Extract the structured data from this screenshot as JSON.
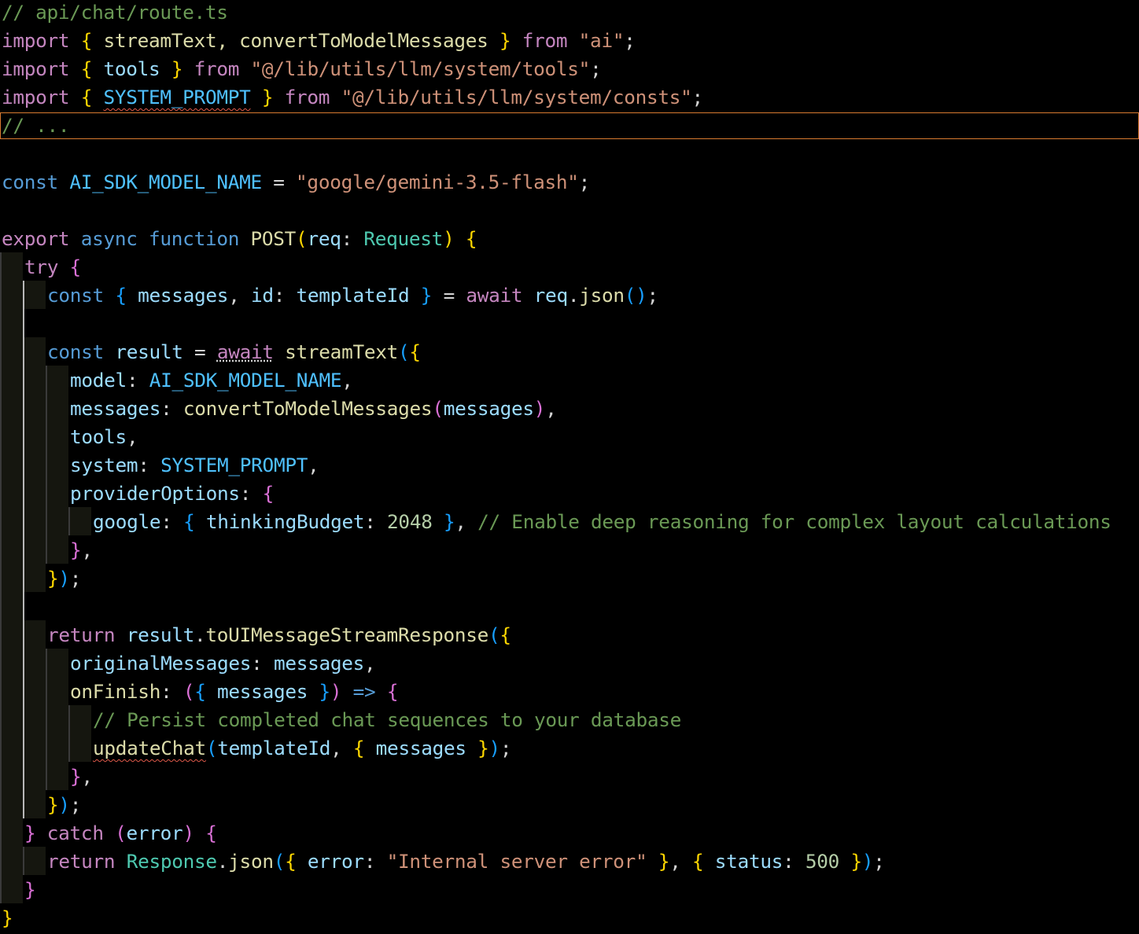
{
  "file_comment": "// api/chat/route.ts",
  "imports": [
    {
      "keyword": "import",
      "names": "streamText, convertToModelMessages",
      "from": "from",
      "source": "\"ai\""
    },
    {
      "keyword": "import",
      "names": "tools",
      "from": "from",
      "source": "\"@/lib/utils/llm/system/tools\""
    },
    {
      "keyword": "import",
      "names": "SYSTEM_PROMPT",
      "from": "from",
      "source": "\"@/lib/utils/llm/system/consts\""
    }
  ],
  "ellipsis_comment": "// ...",
  "model_const": {
    "keyword": "const",
    "name": "AI_SDK_MODEL_NAME",
    "value": "\"google/gemini-3.5-flash\""
  },
  "function_sig": {
    "export": "export",
    "async": "async",
    "function": "function",
    "name": "POST",
    "param": "req",
    "param_type": "Request"
  },
  "body": {
    "try": "try",
    "destructure_messages": "messages",
    "destructure_id": "id",
    "destructure_alias": "templateId",
    "req_json": "json",
    "result_var": "result",
    "stream_fn": "streamText",
    "prop_model": "model",
    "prop_messages": "messages",
    "convert_fn": "convertToModelMessages",
    "prop_tools": "tools",
    "prop_system": "system",
    "system_value": "SYSTEM_PROMPT",
    "prop_provider": "providerOptions",
    "google_key": "google",
    "thinking_key": "thinkingBudget",
    "thinking_value": "2048",
    "thinking_comment": "// Enable deep reasoning for complex layout calculations",
    "return_kw": "return",
    "to_stream_fn": "toUIMessageStreamResponse",
    "prop_original": "originalMessages",
    "prop_onfinish": "onFinish",
    "persist_comment": "// Persist completed chat sequences to your database",
    "update_fn": "updateChat",
    "catch_kw": "catch",
    "error_var": "error",
    "response_cls": "Response",
    "error_key": "error",
    "error_msg": "\"Internal server error\"",
    "status_key": "status",
    "status_value": "500"
  },
  "colors": {
    "background": "#000000",
    "current_line_border": "#d97a30",
    "keyword_control": "#c586c0",
    "keyword_storage": "#569cd6",
    "function": "#dcdcaa",
    "variable": "#9cdcfe",
    "constant": "#4fc1ff",
    "string": "#ce9178",
    "comment": "#6a9955",
    "type": "#4ec9b0",
    "number": "#b5cea8",
    "bracket_1": "#ffd700",
    "bracket_2": "#da70d6",
    "bracket_3": "#179fff",
    "error_squiggle": "#e05a4a"
  }
}
